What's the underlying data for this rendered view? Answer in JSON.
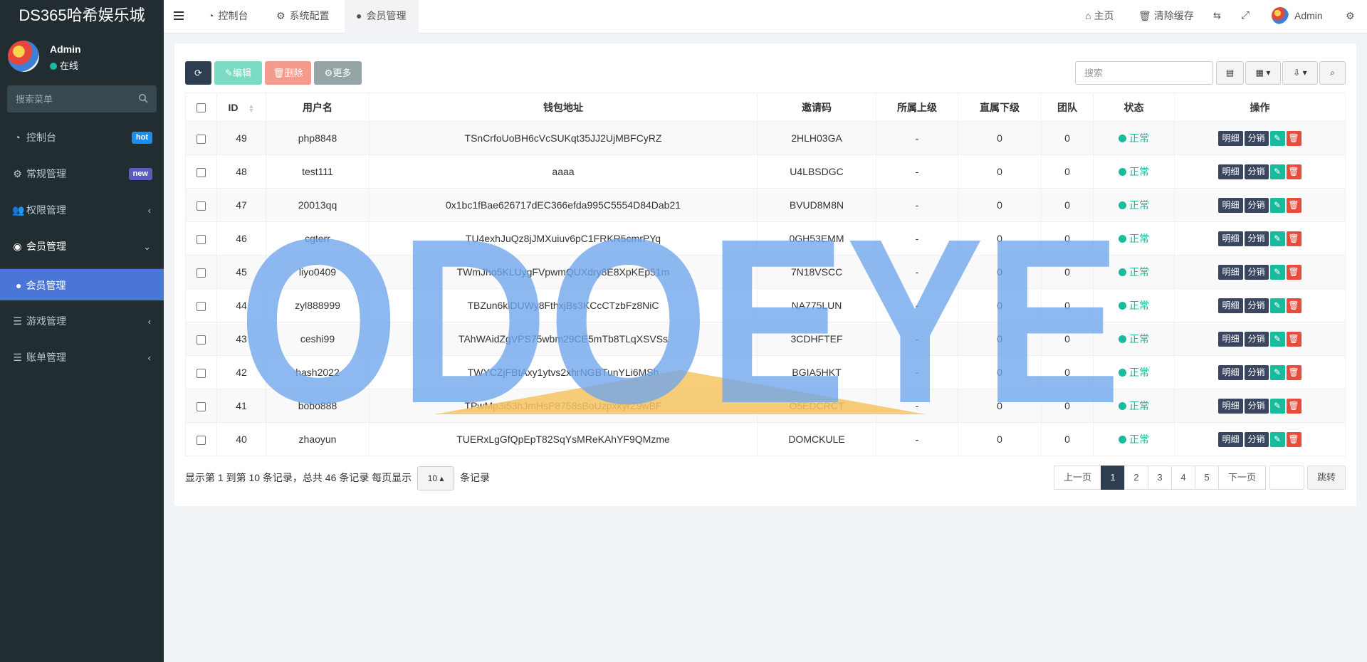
{
  "sidebar": {
    "brand": "DS365哈希娱乐城",
    "user_name": "Admin",
    "user_status": "在线",
    "search_placeholder": "搜索菜单",
    "items": [
      {
        "label": "控制台",
        "icon": "dashboard-icon",
        "badge": "hot"
      },
      {
        "label": "常规管理",
        "icon": "cogs-icon",
        "badge": "new"
      },
      {
        "label": "权限管理",
        "icon": "group-icon"
      },
      {
        "label": "会员管理",
        "icon": "user-circle-icon"
      },
      {
        "label": "游戏管理",
        "icon": "list-icon"
      },
      {
        "label": "账单管理",
        "icon": "list-icon"
      }
    ],
    "sub_item": "会员管理"
  },
  "topbar": {
    "tabs": [
      {
        "label": "控制台",
        "icon": "dashboard-icon"
      },
      {
        "label": "系统配置",
        "icon": "gear-icon"
      },
      {
        "label": "会员管理",
        "icon": "user-icon"
      }
    ],
    "home": "主页",
    "clear_cache": "清除缓存",
    "user": "Admin"
  },
  "toolbar": {
    "edit": "编辑",
    "delete": "删除",
    "more": "更多",
    "search_placeholder": "搜索"
  },
  "table": {
    "headers": [
      "ID",
      "用户名",
      "钱包地址",
      "邀请码",
      "所属上级",
      "直属下级",
      "团队",
      "状态",
      "操作"
    ],
    "op_labels": [
      "明细",
      "分销"
    ],
    "rows": [
      {
        "id": "49",
        "username": "php8848",
        "wallet": "TSnCrfoUoBH6cVcSUKqt35JJ2UjMBFCyRZ",
        "invite": "2HLH03GA",
        "parent": "-",
        "direct": "0",
        "team": "0",
        "status": "正常"
      },
      {
        "id": "48",
        "username": "test111",
        "wallet": "aaaa",
        "invite": "U4LBSDGC",
        "parent": "-",
        "direct": "0",
        "team": "0",
        "status": "正常"
      },
      {
        "id": "47",
        "username": "20013qq",
        "wallet": "0x1bc1fBae626717dEC366efda995C5554D84Dab21",
        "invite": "BVUD8M8N",
        "parent": "-",
        "direct": "0",
        "team": "0",
        "status": "正常"
      },
      {
        "id": "46",
        "username": "cgterr",
        "wallet": "TU4exhJuQz8jJMXuiuv6pC1FRKR5cmrPYq",
        "invite": "0GH53EMM",
        "parent": "-",
        "direct": "0",
        "team": "0",
        "status": "正常"
      },
      {
        "id": "45",
        "username": "liyo0409",
        "wallet": "TWmJho5KLUygFVpwmQUXdry8E8XpKEp51m",
        "invite": "7N18VSCC",
        "parent": "-",
        "direct": "0",
        "team": "0",
        "status": "正常"
      },
      {
        "id": "44",
        "username": "zyl888999",
        "wallet": "TBZun6kiDUWy8FthxjBs3KCcCTzbFz8NiC",
        "invite": "NA775LUN",
        "parent": "-",
        "direct": "0",
        "team": "0",
        "status": "正常"
      },
      {
        "id": "43",
        "username": "ceshi99",
        "wallet": "TAhWAidZgVPS75wbm29CE5mTb8TLqXSVSs",
        "invite": "3CDHFTEF",
        "parent": "-",
        "direct": "0",
        "team": "0",
        "status": "正常"
      },
      {
        "id": "42",
        "username": "hash2022",
        "wallet": "TWYCZjFBtAxy1ytvs2xhrNGBTunYLi6MSh",
        "invite": "BGIA5HKT",
        "parent": "-",
        "direct": "0",
        "team": "0",
        "status": "正常"
      },
      {
        "id": "41",
        "username": "bobo888",
        "wallet": "TPwMp3i53hJmHsP8758sBoUzpxkyrZ9wBF",
        "invite": "O5EDCRCT",
        "parent": "-",
        "direct": "0",
        "team": "0",
        "status": "正常"
      },
      {
        "id": "40",
        "username": "zhaoyun",
        "wallet": "TUERxLgGfQpEpT82SqYsMReKAhYF9QMzme",
        "invite": "DOMCKULE",
        "parent": "-",
        "direct": "0",
        "team": "0",
        "status": "正常"
      }
    ]
  },
  "footer": {
    "info_prefix": "显示第 1 到第 10 条记录，总共 46 条记录 每页显示",
    "page_size": "10",
    "info_suffix": "条记录",
    "prev": "上一页",
    "pages": [
      "1",
      "2",
      "3",
      "4",
      "5"
    ],
    "next": "下一页",
    "jump": "跳转"
  },
  "watermark": {
    "text": "ODOEYE",
    "colors": {
      "letters": "#6ea5ec",
      "wedge": "#f7c462"
    }
  }
}
